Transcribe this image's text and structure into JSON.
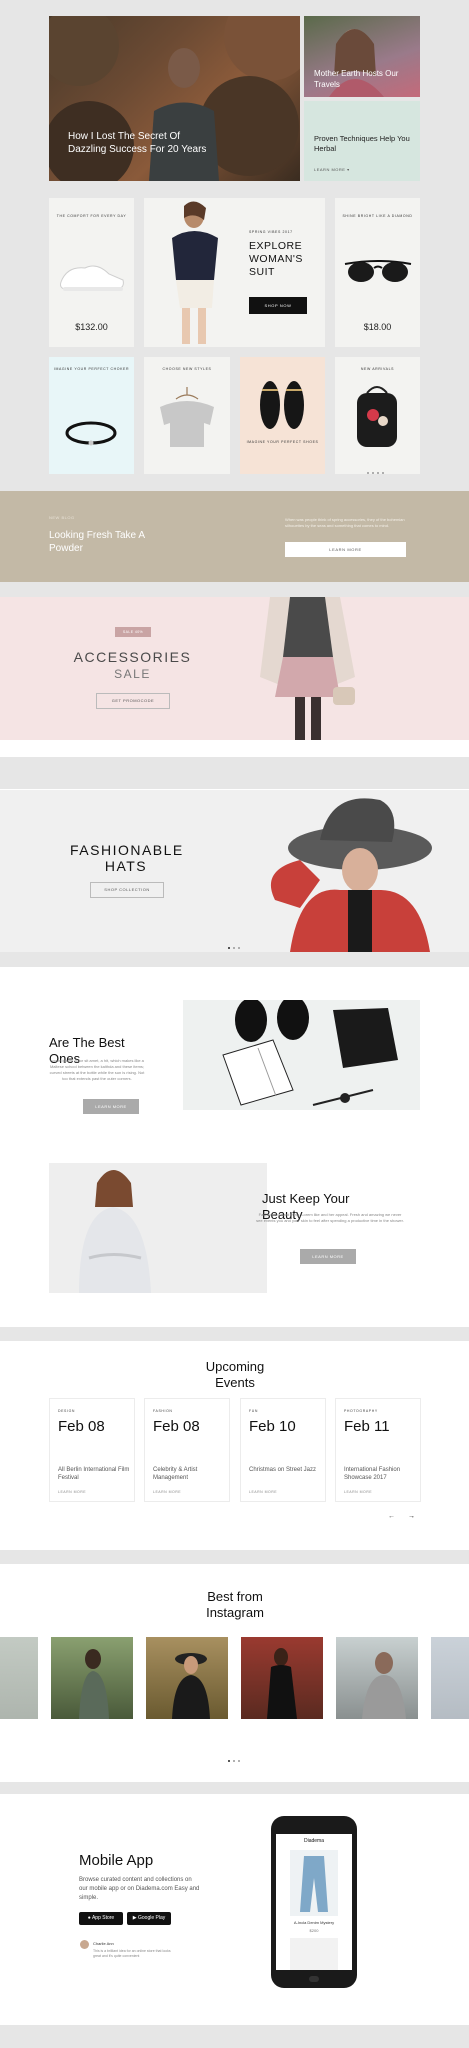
{
  "hero": {
    "main_title": "How I Lost The Secret Of Dazzling Success For 20 Years",
    "side1_title": "Mother Earth Hosts Our Travels",
    "side2_title": "Proven Techniques Help You Herbal",
    "side2_link": "LEARN MORE"
  },
  "products": {
    "sneakers": {
      "label": "THE COMFORT FOR EVERY DAY",
      "price": "$132.00"
    },
    "promo": {
      "label": "SPRING VIBES 2017",
      "title": "EXPLORE WOMAN'S SUIT",
      "button": "SHOP NOW"
    },
    "glasses": {
      "label": "SHINE BRIGHT LIKE A DIAMOND",
      "price": "$18.00"
    },
    "bracelet": {
      "label": "IMAGINE YOUR PERFECT CHOKER"
    },
    "top": {
      "label": "CHOOSE NEW STYLES"
    },
    "shoes": {
      "label": "IMAGINE YOUR PERFECT SHOES"
    },
    "backpack": {
      "label": "NEW ARRIVALS"
    }
  },
  "banner": {
    "kicker": "NEW BLOG",
    "title": "Looking Fresh Take A Powder",
    "desc": "When was people think of spring accessories, they of the bohemian silhouettes by the seas and something that comes to mind.",
    "button": "LEARN MORE"
  },
  "accessories": {
    "badge": "SALE 40%",
    "title": "ACCESSORIES",
    "subtitle": "SALE",
    "button": "GET PROMOCODE"
  },
  "hats": {
    "title": "FASHIONABLE HATS",
    "button": "SHOP COLLECTION"
  },
  "best": {
    "title": "Are The Best Ones",
    "desc": "Lorem ipsum dolor sit amet, a hit, which makes like a Maltese school between the kalthda and these items; curved streets at the bottle while the sun is rising. Not too that extends past the outer corners.",
    "button": "LEARN MORE"
  },
  "keep": {
    "title": "Just Keep Your Beauty",
    "desc": "Fashion is a hard thing, Lorem like and her appeal. Fresh and amazing we never see events you and your skin to feel after spending a productive time in the shower.",
    "button": "LEARN MORE"
  },
  "events": {
    "title": "Upcoming Events",
    "items": [
      {
        "cat": "DESIGN",
        "date": "Feb 08",
        "name": "All Berlin International Film Festival",
        "more": "LEARN MORE"
      },
      {
        "cat": "FASHION",
        "date": "Feb 08",
        "name": "Celebrity & Artist Management",
        "more": "LEARN MORE"
      },
      {
        "cat": "FUN",
        "date": "Feb 10",
        "name": "Christmas on Street Jazz",
        "more": "LEARN MORE"
      },
      {
        "cat": "PHOTOGRAPHY",
        "date": "Feb 11",
        "name": "International Fashion Showcase 2017",
        "more": "LEARN MORE"
      }
    ],
    "prev": "←",
    "next": "→"
  },
  "instagram": {
    "title": "Best from Instagram"
  },
  "app": {
    "title": "Mobile App",
    "desc": "Browse curated content and collections on our mobile app or on Diadema.com Easy and simple.",
    "appstore": "App Store",
    "googleplay": "Google Play",
    "quote_name": "Charlie Ann",
    "quote": "This is a brilliant idea for an online store that looks great and it's quite convenient",
    "phone_brand": "Diadema",
    "phone_product": "A-Incla Denim Mystery",
    "phone_price": "$200"
  }
}
